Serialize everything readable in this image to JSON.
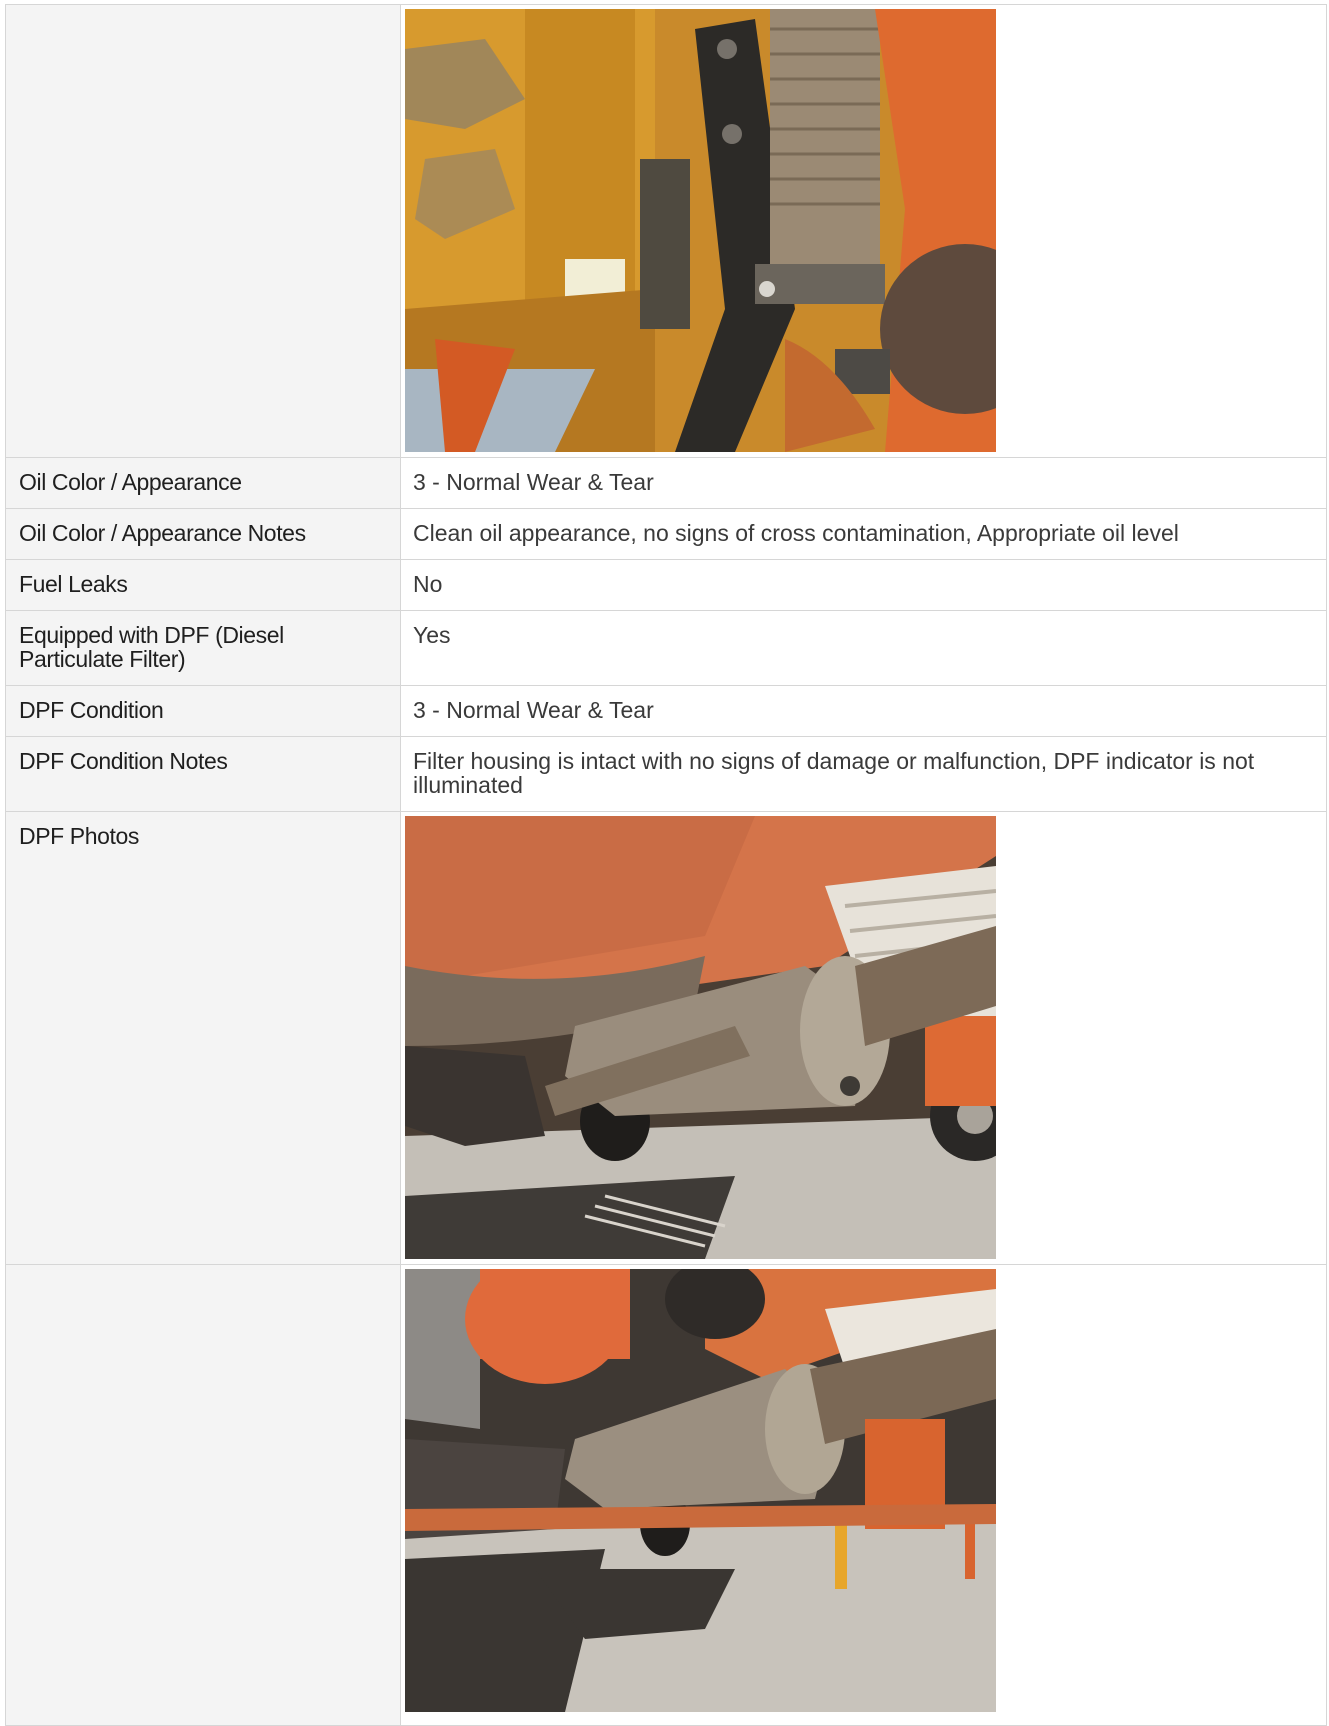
{
  "rows": [
    {
      "label": "",
      "type": "photo",
      "photo": "orange-engine-underside-photo"
    },
    {
      "label": "Oil Color / Appearance",
      "value": "3 - Normal Wear & Tear"
    },
    {
      "label": "Oil Color / Appearance Notes",
      "value": "Clean oil appearance, no signs of cross contamination, Appropriate oil level"
    },
    {
      "label": "Fuel Leaks",
      "value": "No"
    },
    {
      "label": "Equipped with DPF (Diesel Particulate Filter)",
      "value": "Yes"
    },
    {
      "label": "DPF Condition",
      "value": "3 - Normal Wear & Tear"
    },
    {
      "label": "DPF Condition Notes",
      "value": "Filter housing is intact with no signs of damage or malfunction, DPF indicator is not illuminated"
    },
    {
      "label": "DPF Photos",
      "type": "photo",
      "photo": "dpf-underside-photo-1"
    },
    {
      "label": "",
      "type": "photo",
      "photo": "dpf-underside-photo-2"
    }
  ],
  "colors": {
    "label_bg": "#f4f4f4",
    "border": "#d6d6d6",
    "truck_orange": "#e2622a",
    "engine_yellow": "#d79a2e"
  }
}
